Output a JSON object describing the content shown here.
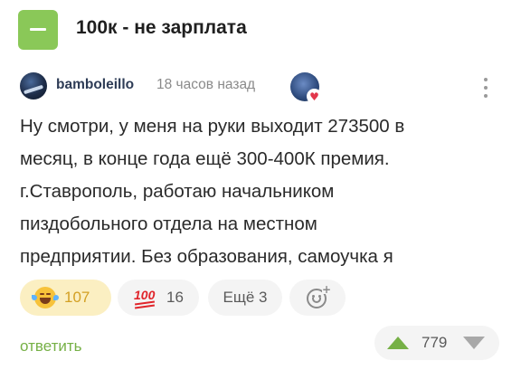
{
  "story": {
    "title": "100к - не зарплата",
    "collapse_icon": "minus-icon",
    "accent_color": "#8ac858"
  },
  "comment": {
    "author": "bamboleillo",
    "time": "18 часов назад",
    "avatar_icon": "avatar-image",
    "badge_icon": "heart-badge-icon",
    "menu_icon": "more-vertical-icon",
    "text_lines": [
      "Ну смотри, у меня на руки выходит 273500 в",
      "месяц, в конце года ещё 300-400К премия.",
      "г.Ставрополь, работаю начальником",
      "пиздобольного отдела на местном",
      "предприятии. Без образования, самоучка я"
    ],
    "reactions": [
      {
        "emoji": "laughing-tears-emoji",
        "count": "107"
      },
      {
        "emoji": "hundred-points-emoji",
        "count": "16"
      }
    ],
    "more_reactions_label": "Ещё 3",
    "add_reaction_icon": "add-emoji-icon",
    "reply_label": "ответить",
    "rating": "779",
    "upvote_icon": "upvote-arrow-icon",
    "downvote_icon": "downvote-arrow-icon"
  }
}
